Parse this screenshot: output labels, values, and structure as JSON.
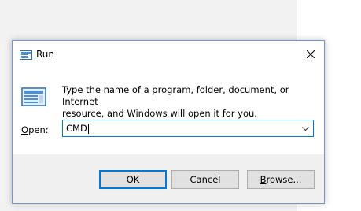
{
  "dialog": {
    "title": "Run",
    "description_line1": "Type the name of a program, folder, document, or Internet",
    "description_line2": "resource, and Windows will open it for you.",
    "open_label_accel": "O",
    "open_label_rest": "pen:",
    "input_value": "CMD"
  },
  "buttons": {
    "ok_label": "OK",
    "cancel_label": "Cancel",
    "browse_label_accel": "B",
    "browse_label_rest": "rowse..."
  },
  "colors": {
    "accent": "#0078d7",
    "dialog_border": "#7a97c4",
    "button_face": "#e1e1e1",
    "button_border": "#adadad"
  }
}
